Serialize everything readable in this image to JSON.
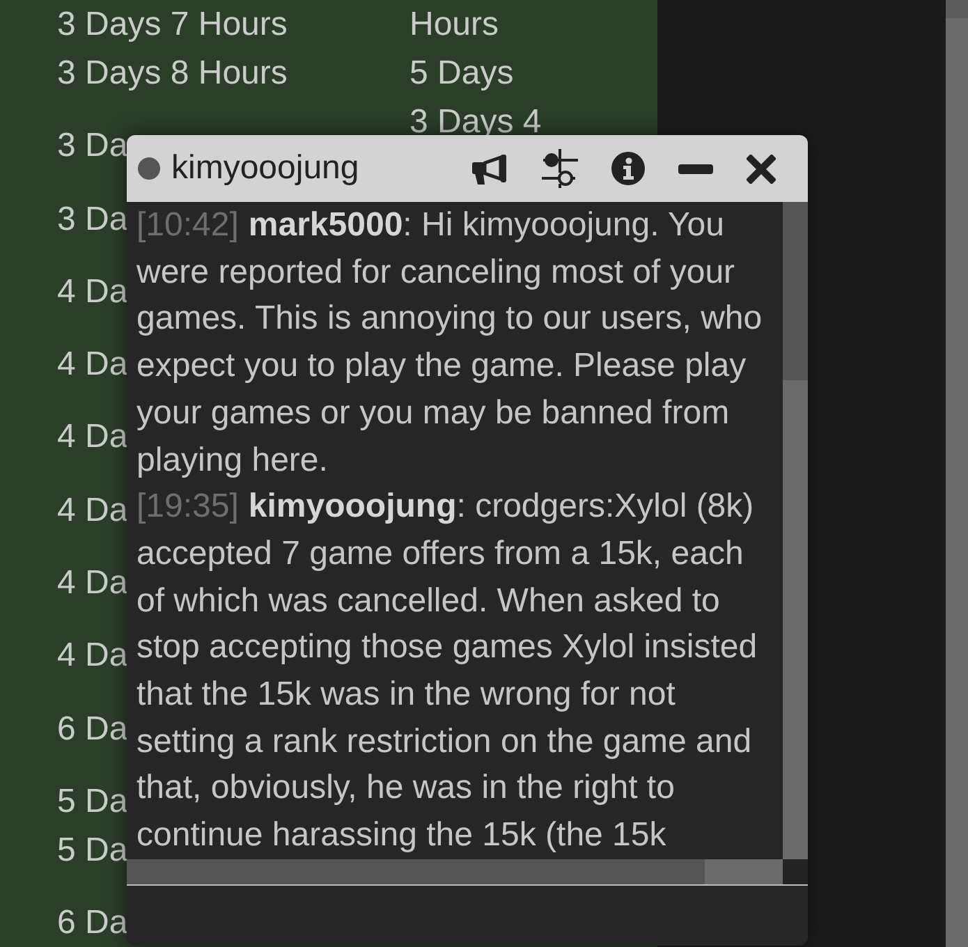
{
  "background_list": {
    "column_1": [
      "3 Days 7 Hours",
      "3 Days 8 Hours",
      "3 Da",
      "3 Da",
      "4 Da",
      "4 Da",
      "4 Da",
      "4 Da",
      "4 Da",
      "4 Da",
      "6 Da",
      "5 Da",
      "5 Da",
      "6 Da"
    ],
    "column_2": [
      "Hours",
      "5 Days",
      "3 Days 4"
    ]
  },
  "chat": {
    "title": "kimyooojung",
    "online": false,
    "messages": [
      {
        "time": "[10:42]",
        "text": "**mark5000**: Hi kimyooojung. You were reported for canceling most of your games. This is annoying to our users, who expect you to play the game. Please play your games or you may be banned from playing here."
      },
      {
        "time": "[19:35]",
        "text": "**kimyooojung**: crodgers:Xylol (8k) accepted 7 game offers from a 15k, each of which was cancelled. When asked to stop accepting those games Xylol insisted that the 15k was in the wrong for not setting a rank restriction on the game and that, obviously, he was in the right to continue harassing the 15k (the 15k"
      }
    ]
  }
}
